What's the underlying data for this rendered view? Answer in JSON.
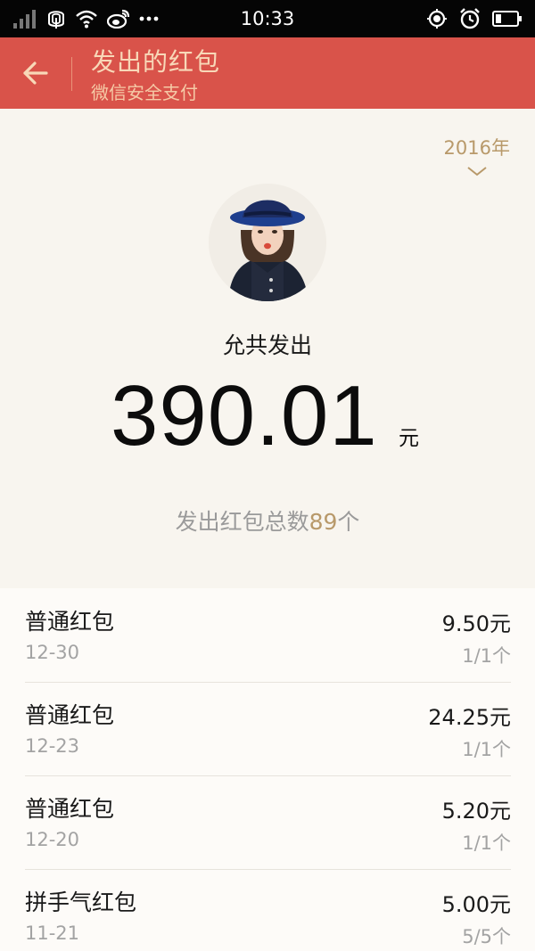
{
  "status_bar": {
    "time": "10:33",
    "background": "#050505",
    "left_icons": [
      "signal-icon",
      "carrier-icon",
      "wifi-icon",
      "weibo-icon",
      "more-dots-icon"
    ],
    "right_icons": [
      "location-icon",
      "alarm-icon",
      "battery-icon"
    ]
  },
  "header": {
    "title": "发出的红包",
    "subtitle": "微信安全支付",
    "background": "#d9534a",
    "back_icon": "back-arrow-icon"
  },
  "summary": {
    "year": "2016年",
    "total_label": "允共发出",
    "total_amount": "390.01",
    "total_unit": "元",
    "count_prefix": "发出红包总数",
    "count_value": "89",
    "count_suffix": "个",
    "accent_color": "#b8996a"
  },
  "packets": [
    {
      "type": "普通红包",
      "date": "12-30",
      "amount": "9.50元",
      "claimed": "1/1个"
    },
    {
      "type": "普通红包",
      "date": "12-23",
      "amount": "24.25元",
      "claimed": "1/1个"
    },
    {
      "type": "普通红包",
      "date": "12-20",
      "amount": "5.20元",
      "claimed": "1/1个"
    },
    {
      "type": "拼手气红包",
      "date": "11-21",
      "amount": "5.00元",
      "claimed": "5/5个"
    }
  ]
}
